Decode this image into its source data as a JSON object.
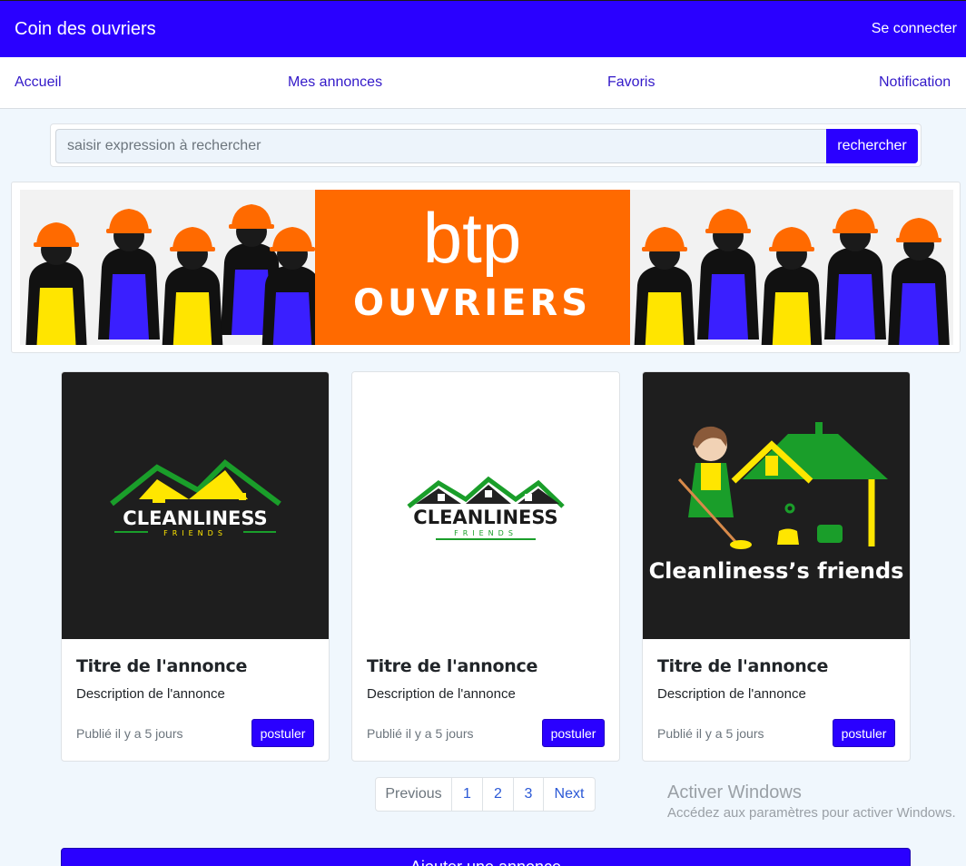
{
  "header": {
    "brand": "Coin des ouvriers",
    "login": "Se connecter",
    "color": "#2a00ff"
  },
  "nav": {
    "items": [
      "Accueil",
      "Mes annonces",
      "Favoris",
      "Notification"
    ]
  },
  "search": {
    "placeholder": "saisir expression à rechercher",
    "button": "rechercher"
  },
  "banner": {
    "title": "btp",
    "subtitle": "OUVRIERS"
  },
  "cards": [
    {
      "logo_text": "CLEANLINESS",
      "logo_sub": "FRIENDS",
      "title": "Titre de l'annonce",
      "description": "Description de l'annonce",
      "meta": "Publié il y a 5 jours",
      "button": "postuler"
    },
    {
      "logo_text": "CLEANLINESS",
      "logo_sub": "FRIENDS",
      "title": "Titre de l'annonce",
      "description": "Description de l'annonce",
      "meta": "Publié il y a 5 jours",
      "button": "postuler"
    },
    {
      "logo_text": "Cleanliness’s friends",
      "title": "Titre de l'annonce",
      "description": "Description de l'annonce",
      "meta": "Publié il y a 5 jours",
      "button": "postuler"
    }
  ],
  "pagination": {
    "previous": "Previous",
    "pages": [
      "1",
      "2",
      "3"
    ],
    "next": "Next"
  },
  "watermark": {
    "title": "Activer Windows",
    "subtitle": "Accédez aux paramètres pour activer Windows."
  },
  "footer": {
    "add_button": "Ajouter une annonce"
  }
}
